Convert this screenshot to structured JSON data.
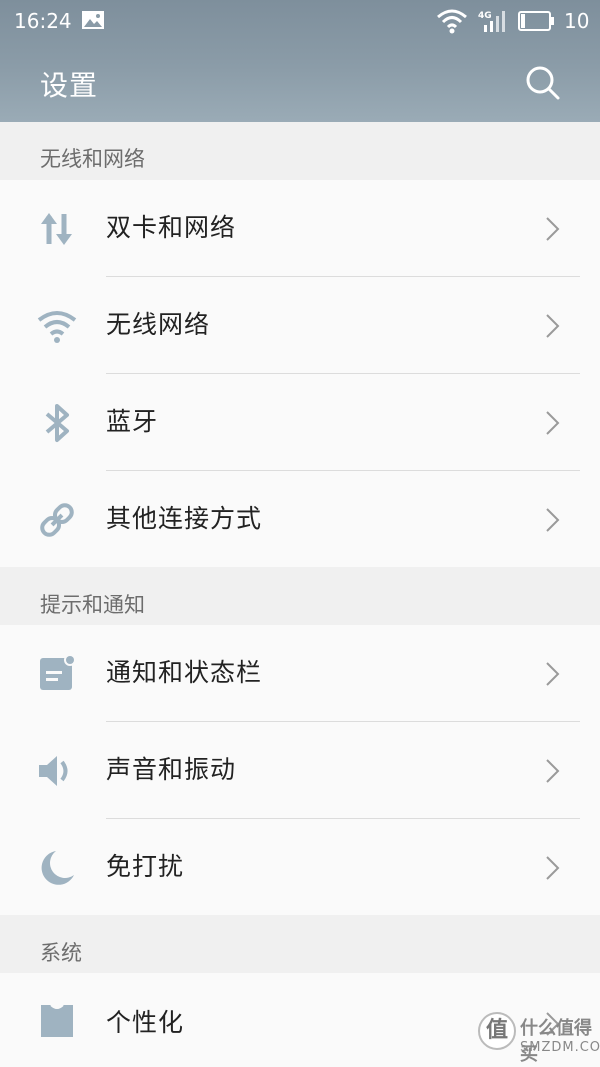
{
  "status_bar": {
    "time": "16:24",
    "network_type": "4G",
    "battery_level": "10",
    "icons": [
      "image-notification-icon",
      "wifi-icon",
      "cell-signal-icon",
      "battery-icon"
    ]
  },
  "header": {
    "title": "设置",
    "search_icon": "search-icon"
  },
  "sections": [
    {
      "title": "无线和网络",
      "items": [
        {
          "label": "双卡和网络",
          "icon": "dual-arrows-icon"
        },
        {
          "label": "无线网络",
          "icon": "wifi-icon"
        },
        {
          "label": "蓝牙",
          "icon": "bluetooth-icon"
        },
        {
          "label": "其他连接方式",
          "icon": "link-icon"
        }
      ]
    },
    {
      "title": "提示和通知",
      "items": [
        {
          "label": "通知和状态栏",
          "icon": "notification-icon"
        },
        {
          "label": "声音和振动",
          "icon": "speaker-icon"
        },
        {
          "label": "免打扰",
          "icon": "moon-icon"
        }
      ]
    },
    {
      "title": "系统",
      "items": [
        {
          "label": "个性化",
          "icon": "shirt-icon"
        }
      ]
    }
  ],
  "watermark": {
    "logo_char": "值",
    "line1": "什么值得买",
    "line2": "SMZDM.COM"
  },
  "colors": {
    "header_gradient_top": "#7e8f9c",
    "header_gradient_bottom": "#9aabb6",
    "icon_color": "#9fb3c1",
    "section_bg": "#f0f0f0",
    "row_bg": "#fafafa"
  }
}
